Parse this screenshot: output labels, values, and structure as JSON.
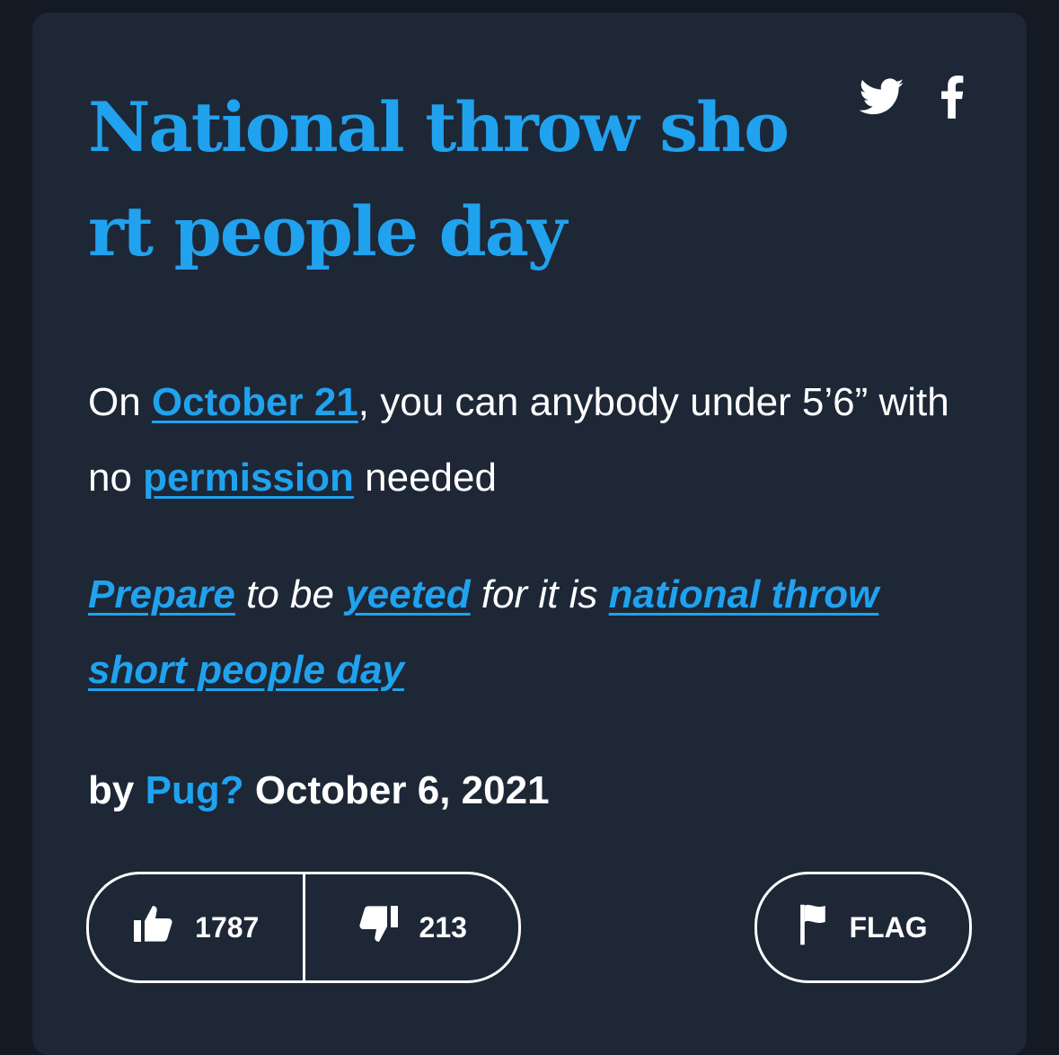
{
  "entry": {
    "title": "National throw short people day",
    "meaning": {
      "part1": "On ",
      "link1": "October 21",
      "part2": ", you can anybody under 5’6” with no ",
      "link2": "permission",
      "part3": " needed"
    },
    "example": {
      "link1": "Prepare",
      "part1": " to be ",
      "link2": "yeeted",
      "part2": " for it is ",
      "link3": "national throw short people day"
    },
    "byline": {
      "prefix": "by",
      "author": "Pug?",
      "date": "October 6, 2021"
    }
  },
  "share": {
    "twitter_icon": "twitter-icon",
    "facebook_icon": "facebook-icon"
  },
  "votes": {
    "up_count": "1787",
    "down_count": "213",
    "up_icon": "thumbs-up-icon",
    "down_icon": "thumbs-down-icon"
  },
  "flag": {
    "label": "FLAG",
    "icon": "flag-icon"
  },
  "colors": {
    "page_background": "#131a23",
    "card_background": "#1d2736",
    "accent": "#20a2ee",
    "text": "#ffffff"
  }
}
